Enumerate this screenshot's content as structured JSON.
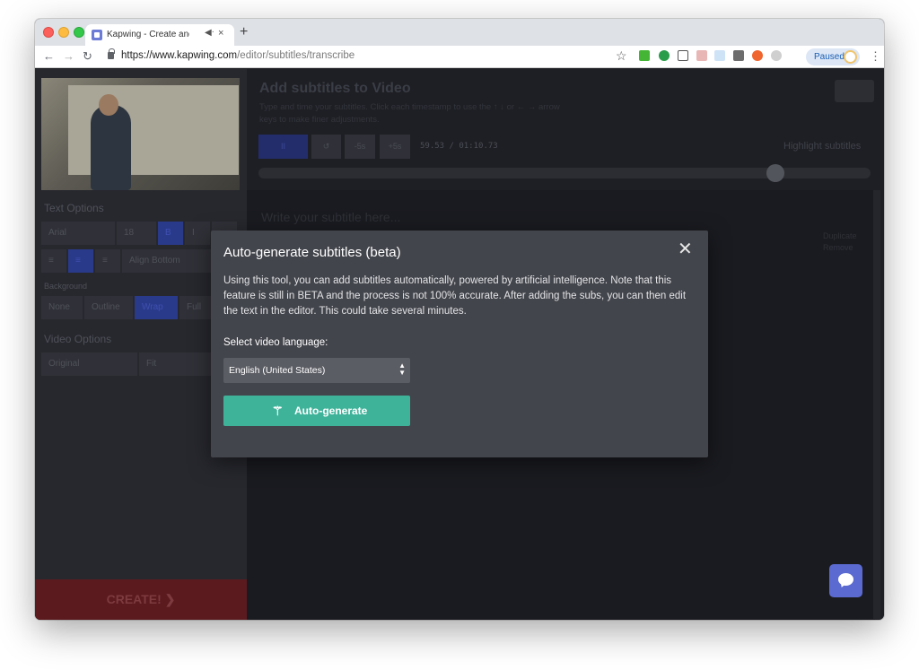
{
  "browser": {
    "tab_title": "Kapwing - Create and Edit",
    "tab_audio_icon": "speaker-icon",
    "tab_close": "×",
    "new_tab": "+",
    "url_host": "https://www.kapwing.com",
    "url_path": "/editor/subtitles/transcribe",
    "paused_label": "Paused",
    "menu": "⋮"
  },
  "sidebar": {
    "text_options_heading": "Text Options",
    "font": "Arial",
    "font_size": "18",
    "bold": "B",
    "italic": "I",
    "align_bottom": "Align Bottom",
    "background_heading": "Background",
    "bg_none": "None",
    "bg_outline": "Outline",
    "bg_wrap": "Wrap",
    "bg_full": "Full",
    "video_options_heading": "Video Options",
    "video_size": "Original",
    "video_fit": "Fit",
    "create_label": "CREATE! ❯"
  },
  "main": {
    "title": "Add subtitles to Video",
    "description": "Type and time your subtitles. Click each timestamp to use the ↑ ↓ or ← → arrow keys to make finer adjustments.",
    "play_pause": "II",
    "rewind": "↺",
    "minus5": "-5s",
    "plus5": "+5s",
    "time_current": "59.53",
    "time_total": " / 01:10.73",
    "highlight_label": "Highlight subtitles",
    "subtitle_placeholder": "Write your subtitle here...",
    "duplicate": "Duplicate",
    "remove": "Remove"
  },
  "modal": {
    "title": "Auto-generate subtitles (beta)",
    "close": "✕",
    "description": "Using this tool, you can add subtitles automatically, powered by artificial intelligence. Note that this feature is still in BETA and the process is not 100% accurate. After adding the subs, you can then edit the text in the editor. This could take several minutes.",
    "language_label": "Select video language:",
    "language_value": "English (United States)",
    "button_label": "Auto-generate"
  },
  "colors": {
    "accent_green": "#3fb39a",
    "chat_blue": "#5b6ad0",
    "modal_bg": "#43454c"
  }
}
